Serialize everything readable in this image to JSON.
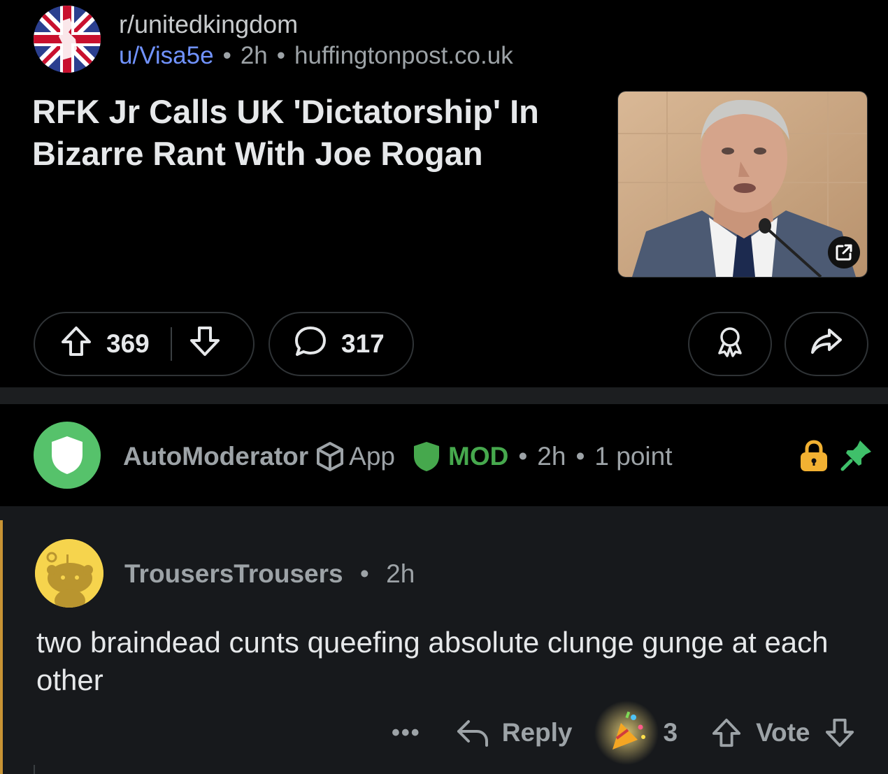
{
  "post": {
    "subreddit": "r/unitedkingdom",
    "author": "u/Visa5e",
    "age": "2h",
    "domain": "huffingtonpost.co.uk",
    "title": "RFK Jr Calls UK 'Dictatorship' In Bizarre Rant With Joe Rogan",
    "upvotes": "369",
    "comments": "317"
  },
  "automod": {
    "name": "AutoModerator",
    "app_label": "App",
    "mod_label": "MOD",
    "age": "2h",
    "points": "1 point"
  },
  "comment": {
    "author": "TrousersTrousers",
    "age": "2h",
    "body": "two braindead cunts queefing absolute clunge gunge at each other",
    "more_label": "•••",
    "reply_label": "Reply",
    "award_count": "3",
    "vote_label": "Vote"
  },
  "icons": {
    "subreddit": "uk-flag-icon",
    "open_link": "external-link-icon",
    "upvote": "upvote-arrow-icon",
    "downvote": "downvote-arrow-icon",
    "comments": "speech-bubble-icon",
    "award": "award-icon",
    "share": "share-arrow-icon",
    "automod_avatar": "shield-icon",
    "app_badge": "cube-icon",
    "mod_badge": "mod-shield-icon",
    "locked": "lock-icon",
    "pinned": "pin-icon",
    "comment_avatar": "snoo-avatar-icon",
    "reply": "reply-arrow-icon",
    "party": "party-popper-icon"
  },
  "colors": {
    "background": "#000000",
    "comment_background": "#17191c",
    "username_link": "#7193ff",
    "mod_green": "#46a84d",
    "automod_avatar": "#56c26b",
    "lock": "#f2b132",
    "pin": "#3fc06a",
    "comment_thread_bar": "#c89434"
  }
}
